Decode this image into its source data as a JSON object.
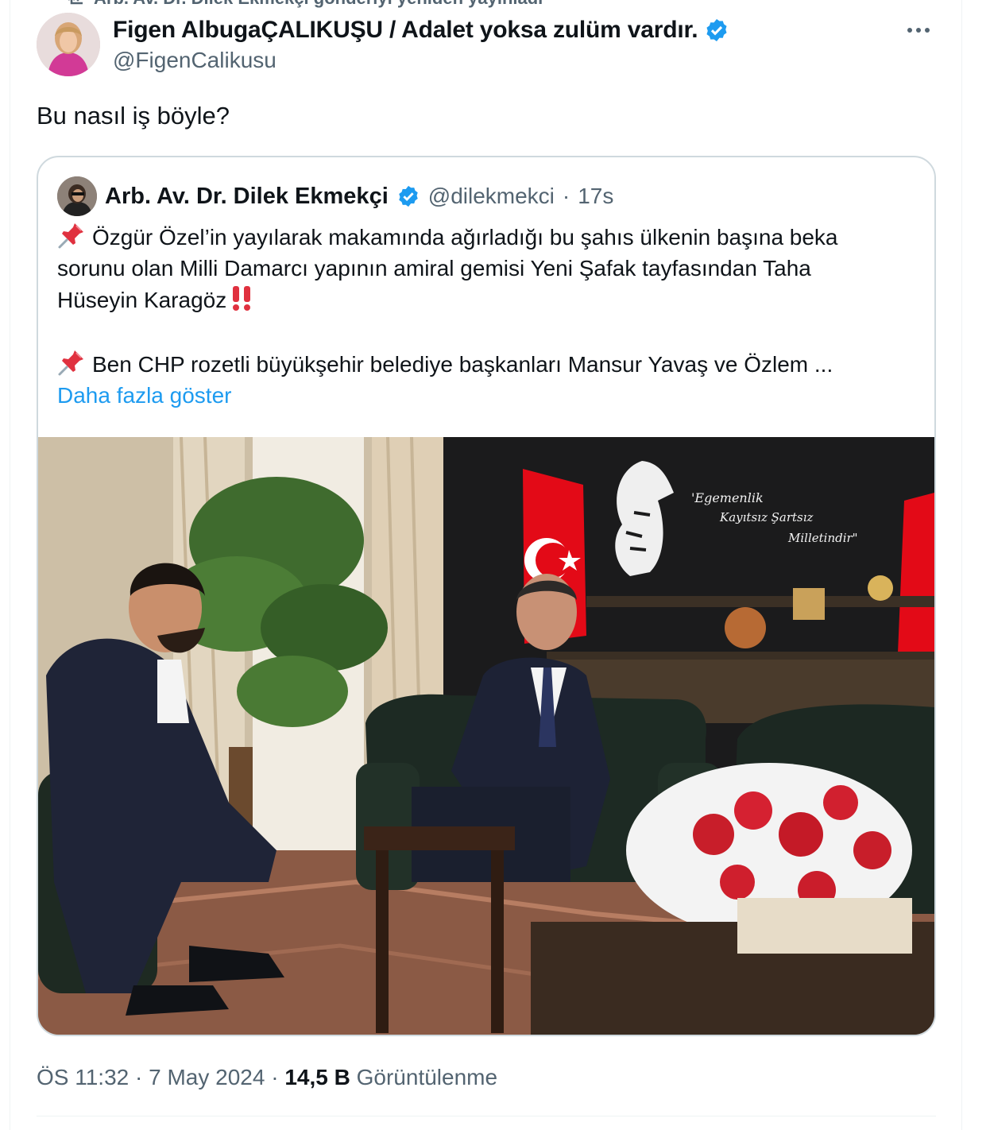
{
  "repost": {
    "text": "Arb. Av. Dr. Dilek Ekmekçi gönderiyi yeniden yayınladı"
  },
  "tweet": {
    "display_name": "Figen AlbugaÇALIKUŞU / Adalet yoksa zulüm vardır.",
    "handle": "@FigenCalikusu",
    "text": "Bu nasıl iş böyle?",
    "time": "ÖS 11:32",
    "date": "7 May 2024",
    "separator": "·",
    "views_count": "14,5 B",
    "views_label": "Görüntülenme"
  },
  "quote": {
    "display_name": "Arb. Av. Dr. Dilek Ekmekçi",
    "handle": "@dilekmekci",
    "separator": "·",
    "time": "17s",
    "lines": [
      "Özgür Özel’in yayılarak makamında ağırladığı bu şahıs ülkenin başına beka",
      "sorunu olan Milli Damarcı yapının amiral gemisi Yeni Şafak tayfasından Taha",
      "Hüseyin Karagöz",
      "Ben CHP rozetli büyükşehir belediye başkanları Mansur Yavaş ve Özlem ..."
    ],
    "show_more": "Daha fazla göster"
  },
  "photo": {
    "wall_quote_1": "'Egemenlik",
    "wall_quote_2": "Kayıtsız Şartsız",
    "wall_quote_3": "Milletindir\""
  },
  "colors": {
    "accent": "#1d9bf0",
    "text": "#0f1419",
    "secondary": "#536471",
    "border": "#cfd9de",
    "flag_red": "#e30a17"
  },
  "icons": {
    "verified": "verified-badge-icon",
    "more": "more-horizontal-icon",
    "pin": "pushpin-emoji-icon",
    "bangs": "double-exclamation-emoji-icon",
    "repost": "repost-icon"
  }
}
